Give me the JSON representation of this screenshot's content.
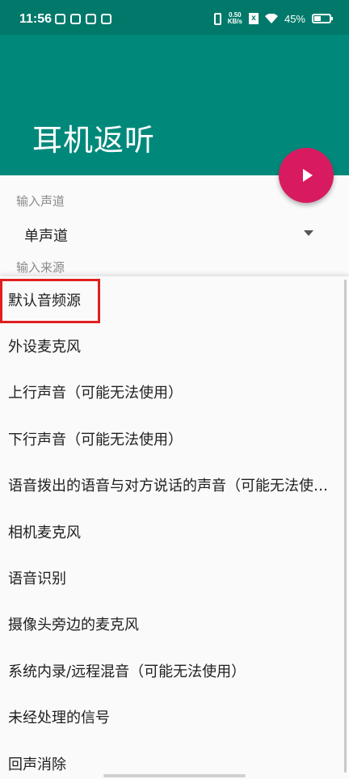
{
  "status_bar": {
    "time": "11:56",
    "net_speed_value": "0.50",
    "net_speed_unit": "KB/s",
    "battery_percent": "45%",
    "battery_level": 0.45,
    "icons": [
      "notification-icon",
      "notification-icon",
      "tiktok-icon",
      "app-icon",
      "vibrate-icon",
      "sim-x-icon",
      "wifi-icon",
      "battery-icon"
    ]
  },
  "app_bar": {
    "title": "耳机返听",
    "background": "#00897b"
  },
  "fab": {
    "icon": "play-icon",
    "color": "#d81b60"
  },
  "form": {
    "input_channel_label": "输入声道",
    "input_channel_value": "单声道",
    "input_source_label": "输入来源"
  },
  "dropdown": {
    "highlighted_index": 0,
    "items": [
      "默认音频源",
      "外设麦克风",
      "上行声音（可能无法使用）",
      "下行声音（可能无法使用）",
      "语音拨出的语音与对方说话的声音（可能无法使用）",
      "相机麦克风",
      "语音识别",
      "摄像头旁边的麦克风",
      "系统内录/远程混音（可能无法使用）",
      "未经处理的信号",
      "回声消除"
    ]
  }
}
